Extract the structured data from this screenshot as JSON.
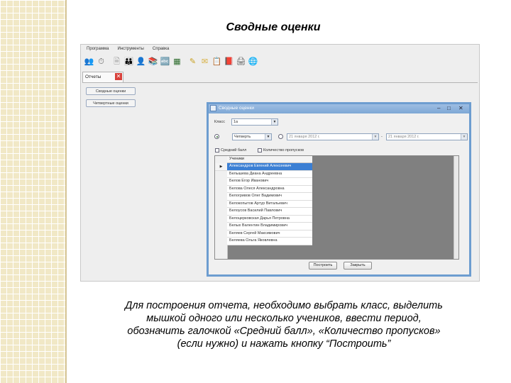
{
  "slide": {
    "title": "Сводные оценки",
    "caption_lines": [
      "Для построения отчета, необходимо выбрать класс, выделить",
      "мышкой одного или несколько учеников, ввести период,",
      "обозначить галочкой «Средний балл», «Количество пропусков»",
      "(если нужно) и нажать кнопку “Построить”"
    ]
  },
  "app": {
    "menu": [
      "Программа",
      "Инструменты",
      "Справка"
    ],
    "toolbar_icons": [
      "users-icon",
      "clock-icon",
      "document-icon",
      "group-icon",
      "person-icon",
      "books-icon",
      "abc-icon",
      "blackboard-icon",
      "pencil-icon",
      "letter-icon",
      "notepad-icon",
      "book-icon",
      "printer-icon",
      "network-icon"
    ],
    "sidebar": {
      "tab_label": "Отчеты",
      "buttons": [
        "Сводные оценки",
        "Четвертные оценки"
      ]
    }
  },
  "dialog": {
    "title": "Сводные оценки",
    "class_label": "Класс",
    "class_value": "1а",
    "period_value": "Четверть",
    "date_from": "21 января 2012 г.",
    "date_to": "21 января 2012 г.",
    "date_separator": "-",
    "checkbox_avg": "Средний балл",
    "checkbox_absences": "Количество пропусков",
    "table_header": "Ученики",
    "students": [
      "Александров Евгений Алексеевич",
      "Белышева Диана Андреевна",
      "Белов Егор Иванович",
      "Белова Олеся Александровна",
      "Белогривов Олег Вадимович",
      "Белокопытов Артур Витальевич",
      "Белоусов Василий Павлович",
      "Белоцерковская Дарья Петровна",
      "Белых Валентин Владимирович",
      "Беляев Сергей Максимович",
      "Беляева Ольга Яковлевна"
    ],
    "selected_row_marker": "▶",
    "build_button": "Построить",
    "close_button": "Закрыть",
    "minimize_glyph": "–",
    "maximize_glyph": "□",
    "close_glyph": "✕"
  }
}
